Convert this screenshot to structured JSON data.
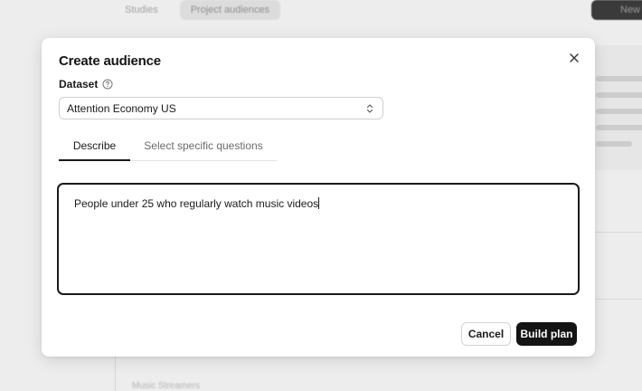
{
  "background": {
    "tabs": [
      "Studies",
      "Project audiences"
    ],
    "new_button_label": "New",
    "side_text": "Music Streamers"
  },
  "modal": {
    "title": "Create audience",
    "dataset": {
      "label": "Dataset",
      "help_icon": "question-circle-icon",
      "selected": "Attention Economy US"
    },
    "tabs": [
      {
        "label": "Describe",
        "active": true
      },
      {
        "label": "Select specific questions",
        "active": false
      }
    ],
    "description_value": "People under 25 who regularly watch music videos",
    "buttons": {
      "cancel": "Cancel",
      "build": "Build plan"
    },
    "close_icon": "close-icon"
  },
  "colors": {
    "primary": "#141414",
    "overlay": "#ededed",
    "border": "#cfcfcf"
  }
}
